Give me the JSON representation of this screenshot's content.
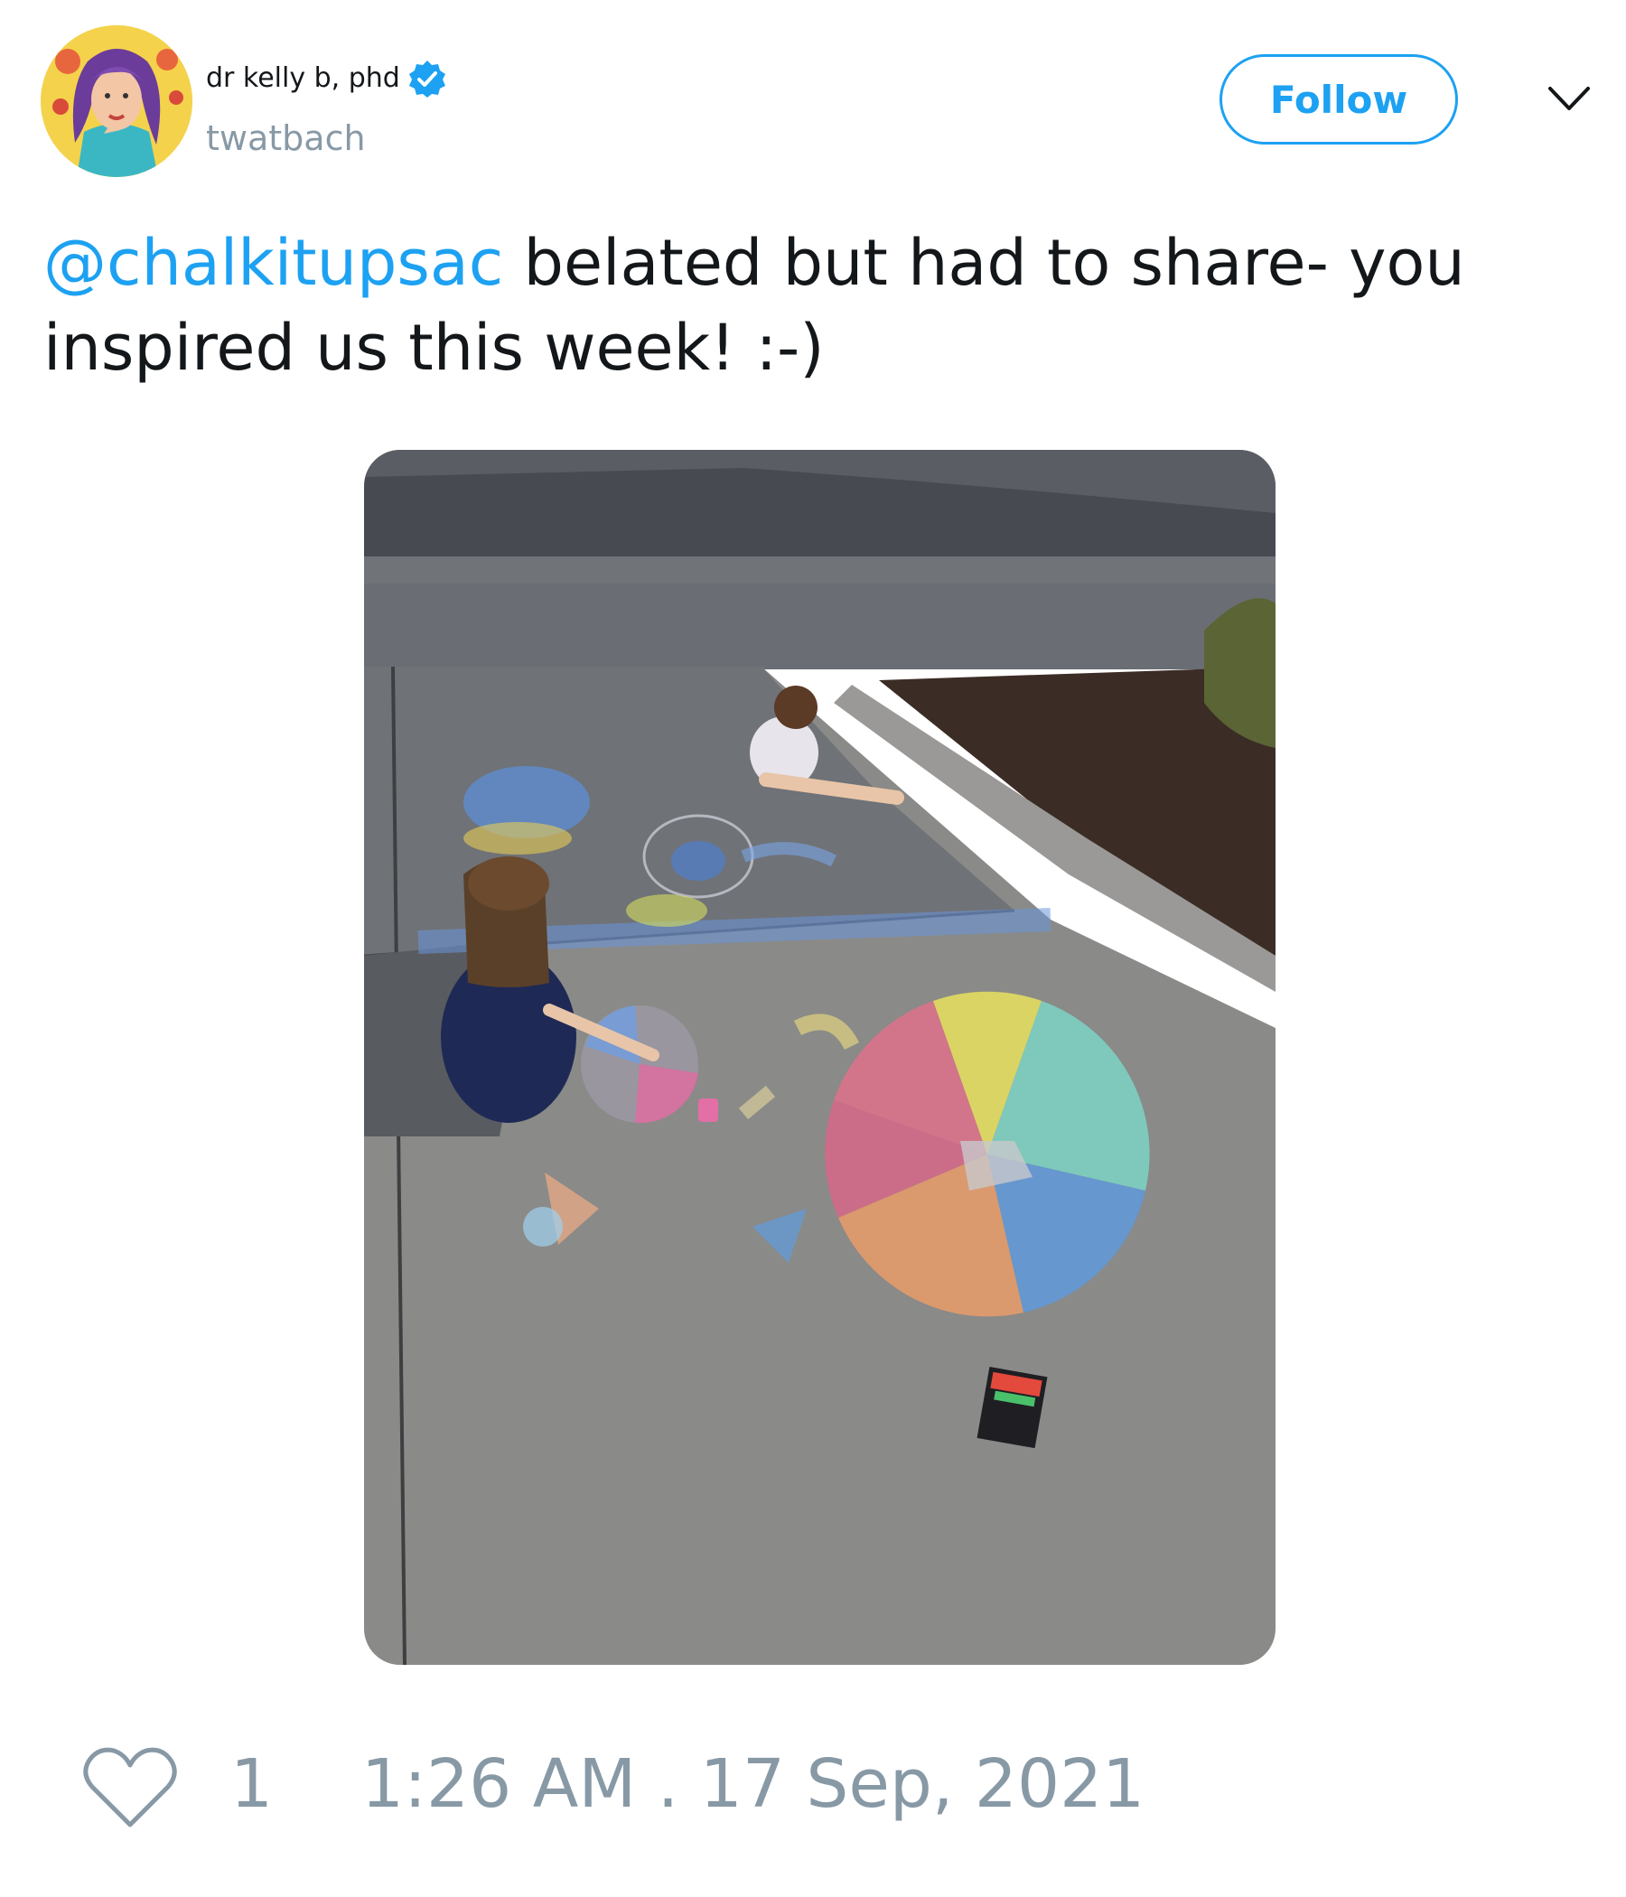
{
  "tweet": {
    "author": {
      "display_name": "dr kelly b, phd",
      "handle": "twatbach",
      "verified": true
    },
    "follow_label": "Follow",
    "text": {
      "mention": "@chalkitupsac",
      "body": " belated but had to share- you inspired us this week! :-)"
    },
    "likes": "1",
    "timestamp": "1:26 AM . 17 Sep, 2021"
  },
  "icons": {
    "verified": "verified-badge-icon",
    "menu": "chevron-down-icon",
    "like": "heart-outline-icon"
  },
  "colors": {
    "accent": "#1da1f2",
    "muted": "#8899a6",
    "text": "#14171a"
  }
}
